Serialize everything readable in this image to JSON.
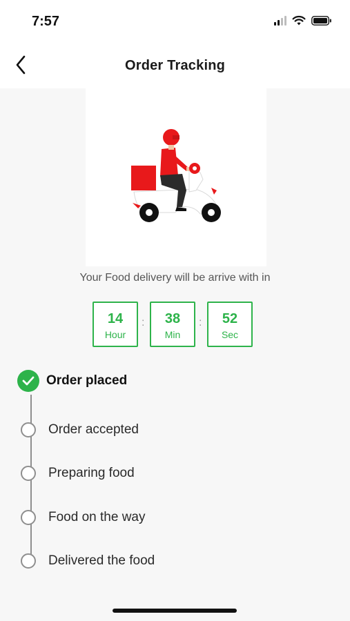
{
  "status_bar": {
    "time": "7:57"
  },
  "header": {
    "title": "Order Tracking",
    "back_icon": "chevron-left-icon"
  },
  "delivery": {
    "message": "Your Food delivery will be arrive with in"
  },
  "countdown": {
    "hours": {
      "value": "14",
      "unit": "Hour"
    },
    "minutes": {
      "value": "38",
      "unit": "Min"
    },
    "seconds": {
      "value": "52",
      "unit": "Sec"
    },
    "separator": ":"
  },
  "steps": [
    {
      "label": "Order placed",
      "status": "done"
    },
    {
      "label": "Order accepted",
      "status": "pending"
    },
    {
      "label": "Preparing food",
      "status": "pending"
    },
    {
      "label": "Food on the way",
      "status": "pending"
    },
    {
      "label": "Delivered the food",
      "status": "pending"
    }
  ],
  "colors": {
    "accent": "#2db34a",
    "rider": "#e8191b",
    "line": "#8e8e8e"
  }
}
